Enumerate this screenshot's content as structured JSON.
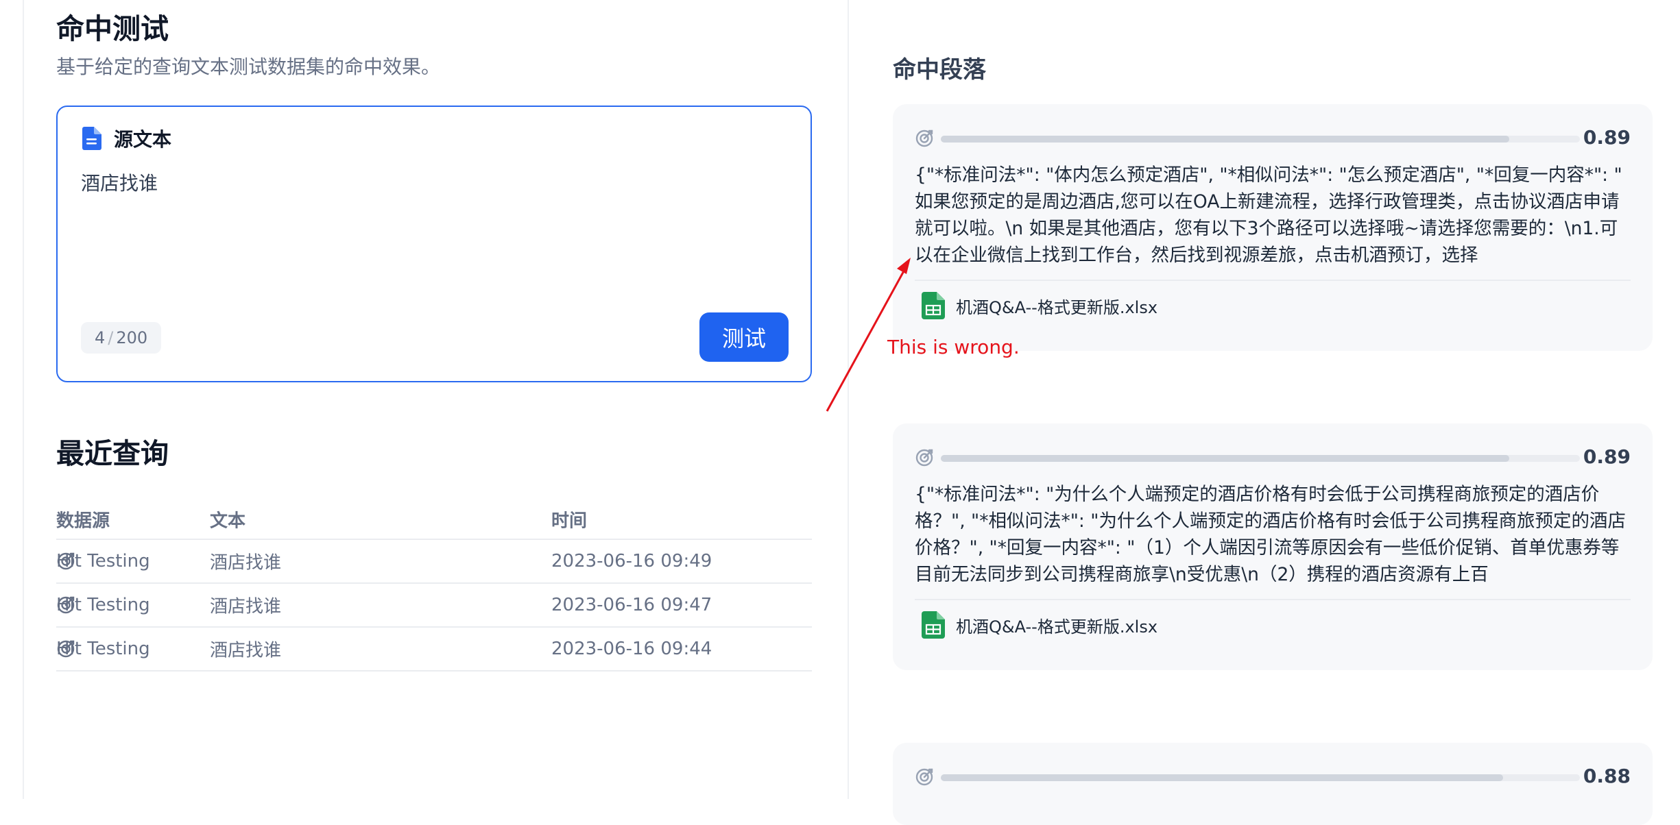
{
  "page": {
    "title": "命中测试",
    "subtitle": "基于给定的查询文本测试数据集的命中效果。"
  },
  "source": {
    "label": "源文本",
    "text": "酒店找谁",
    "count": "4",
    "max": "200",
    "button": "测试"
  },
  "recent": {
    "title": "最近查询",
    "headers": {
      "source": "数据源",
      "text": "文本",
      "time": "时间"
    },
    "rows": [
      {
        "source": "Hit Testing",
        "text": "酒店找谁",
        "time": "2023-06-16 09:49"
      },
      {
        "source": "Hit Testing",
        "text": "酒店找谁",
        "time": "2023-06-16 09:47"
      },
      {
        "source": "Hit Testing",
        "text": "酒店找谁",
        "time": "2023-06-16 09:44"
      }
    ]
  },
  "hits": {
    "title": "命中段落",
    "items": [
      {
        "score": 0.89,
        "score_label": "0.89",
        "text": "{\"*标准问法*\": \"体内怎么预定酒店\", \"*相似问法*\": \"怎么预定酒店\", \"*回复一内容*\": \" 如果您预定的是周边酒店,您可以在OA上新建流程，选择行政管理类，点击协议酒店申请就可以啦。\\n 如果是其他酒店，您有以下3个路径可以选择哦~请选择您需要的：\\n1.可以在企业微信上找到工作台，然后找到视源差旅，点击机酒预订，选择",
        "file": "机酒Q&A--格式更新版.xlsx"
      },
      {
        "score": 0.89,
        "score_label": "0.89",
        "text": "{\"*标准问法*\": \"为什么个人端预定的酒店价格有时会低于公司携程商旅预定的酒店价格？\", \"*相似问法*\": \"为什么个人端预定的酒店价格有时会低于公司携程商旅预定的酒店价格？\", \"*回复一内容*\": \"（1）个人端因引流等原因会有一些低价促销、首单优惠券等目前无法同步到公司携程商旅享\\n受优惠\\n（2）携程的酒店资源有上百",
        "file": "机酒Q&A--格式更新版.xlsx"
      },
      {
        "score": 0.88,
        "score_label": "0.88",
        "text": "",
        "file": ""
      }
    ]
  },
  "annotation": {
    "text": "This is wrong.",
    "color": "#e5131b"
  },
  "colors": {
    "accent": "#1f63f0",
    "excel_green": "#1f9d55"
  }
}
